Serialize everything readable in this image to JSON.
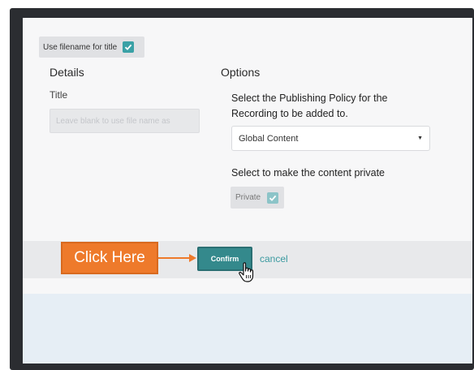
{
  "dialog": {
    "use_filename_label": "Use filename for title",
    "details": {
      "heading": "Details",
      "title_label": "Title",
      "title_placeholder": "Leave blank to use file name as"
    },
    "options": {
      "heading": "Options",
      "policy_text": "Select the Publishing Policy for the Recording to be added to.",
      "policy_selected": "Global Content",
      "private_prompt": "Select to make the content private",
      "private_label": "Private"
    },
    "footer": {
      "callout": "Click Here",
      "confirm_label": "Confirm",
      "cancel_label": "cancel"
    }
  },
  "colors": {
    "accent": "#34898c",
    "callout": "#ee7a2b",
    "link": "#3b9aa0"
  },
  "icons": [
    "checkmark-icon",
    "arrow-right-icon",
    "hand-pointer-icon"
  ]
}
